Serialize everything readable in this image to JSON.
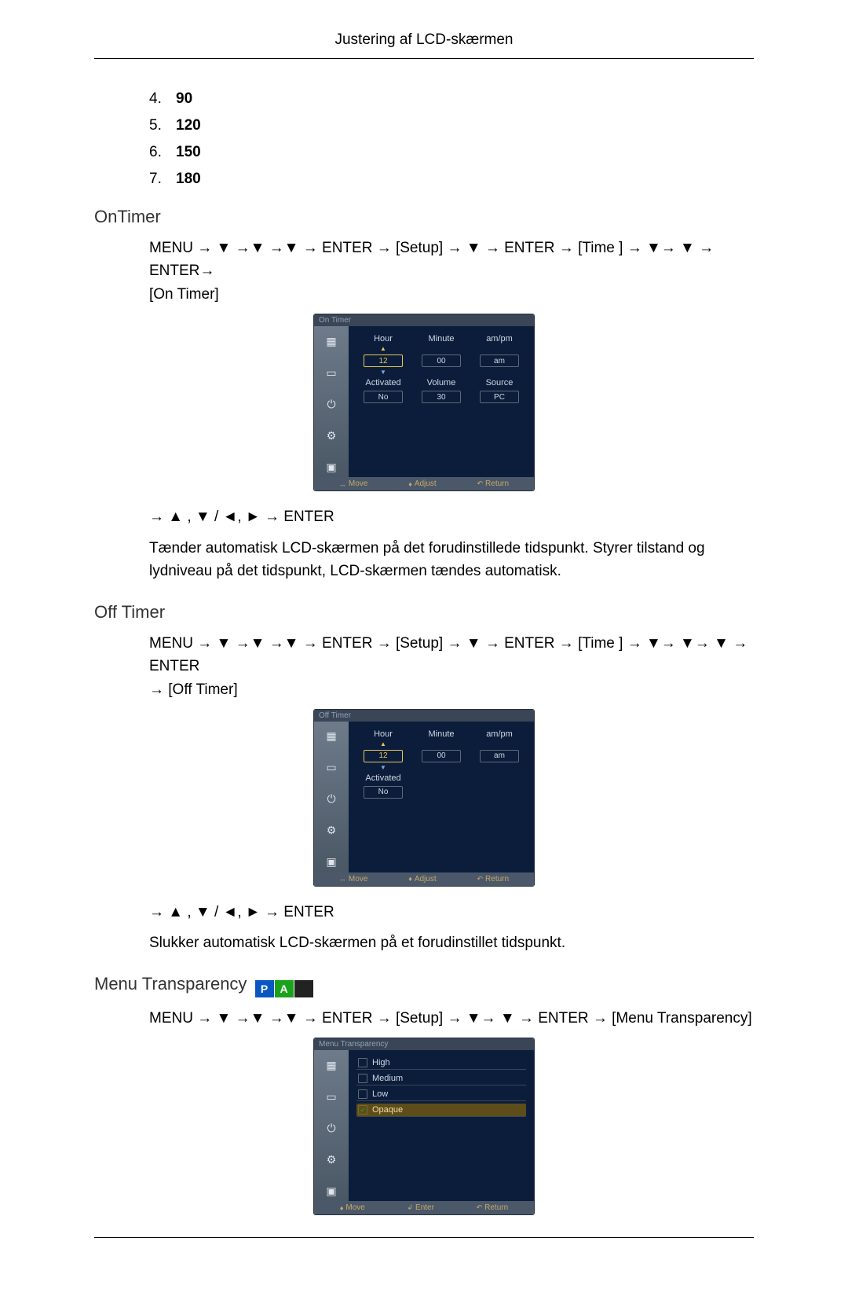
{
  "header": {
    "title": "Justering af LCD-skærmen"
  },
  "number_list": [
    {
      "num": "4.",
      "val": "90"
    },
    {
      "num": "5.",
      "val": "120"
    },
    {
      "num": "6.",
      "val": "150"
    },
    {
      "num": "7.",
      "val": "180"
    }
  ],
  "arrows": {
    "right": "→",
    "down": "▼",
    "up": "▲",
    "left": "◄",
    "rt": "►"
  },
  "nav_labels": {
    "menu": "MENU",
    "enter": "ENTER",
    "setup": "[Setup]",
    "time": "[Time ]",
    "on_timer": "[On Timer]",
    "off_timer": "[Off Timer]",
    "menu_trans": "[Menu Transparency]"
  },
  "on_timer": {
    "title": "OnTimer",
    "nav_suffix_title": "OnTimer",
    "nav1_a": "MENU → ▼ →▼ →▼ → ENTER → [Setup] → ▼ → ENTER → [Time ] → ▼→ ▼ → ENTER→",
    "nav1_b": "[On Timer]",
    "nav2": "→ ▲ , ▼ / ◄, ► → ENTER",
    "desc": "Tænder automatisk LCD-skærmen på det forudinstillede tidspunkt. Styrer tilstand og lydniveau på det tidspunkt, LCD-skærmen tændes automatisk.",
    "osd": {
      "title": "On Timer",
      "row1": {
        "labels": [
          "Hour",
          "Minute",
          "am/pm"
        ],
        "values": [
          "12",
          "00",
          "am"
        ]
      },
      "row2": {
        "labels": [
          "Activated",
          "Volume",
          "Source"
        ],
        "values": [
          "No",
          "30",
          "PC"
        ]
      },
      "footer": {
        "move": "Move",
        "adjust": "Adjust",
        "return": "Return"
      }
    }
  },
  "off_timer": {
    "title": "Off Timer",
    "nav1_a": "MENU → ▼ →▼ →▼ → ENTER → [Setup] → ▼ → ENTER → [Time ] → ▼→ ▼→ ▼ → ENTER",
    "nav1_b": "→ [Off Timer]",
    "nav2": "→ ▲ , ▼ / ◄, ► → ENTER",
    "desc": "Slukker automatisk LCD-skærmen på et forudinstillet tidspunkt.",
    "osd": {
      "title": "Off Timer",
      "row1": {
        "labels": [
          "Hour",
          "Minute",
          "am/pm"
        ],
        "values": [
          "12",
          "00",
          "am"
        ]
      },
      "row2": {
        "labels": [
          "Activated"
        ],
        "values": [
          "No"
        ]
      },
      "footer": {
        "move": "Move",
        "adjust": "Adjust",
        "return": "Return"
      }
    }
  },
  "menu_transparency": {
    "title": "Menu Transparency",
    "nav1": "MENU → ▼ →▼ →▼ → ENTER → [Setup] → ▼→ ▼ → ENTER → [Menu Transparency]",
    "osd": {
      "title": "Menu Transparency",
      "items": [
        "High",
        "Medium",
        "Low",
        "Opaque"
      ],
      "selected_index": 3,
      "footer": {
        "move": "Move",
        "enter": "Enter",
        "return": "Return"
      }
    }
  },
  "icons_pa": {
    "p": "P",
    "a": "A"
  }
}
